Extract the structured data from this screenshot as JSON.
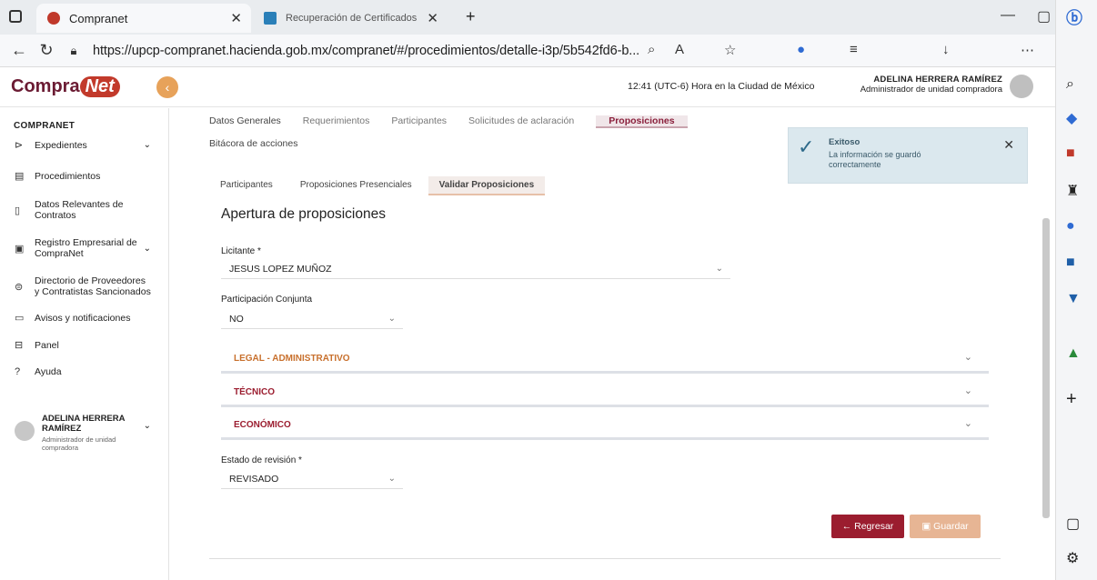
{
  "browser": {
    "tabs": [
      {
        "label": "Compranet",
        "active": true
      },
      {
        "label": "Recuperación de Certificados",
        "active": false
      }
    ],
    "url": "https://upcp-compranet.hacienda.gob.mx/compranet/#/procedimientos/detalle-i3p/5b542fd6-b..."
  },
  "header": {
    "logo_text": "Compra",
    "logo_net": "Net",
    "clock": "12:41 (UTC-6) Hora en la Ciudad de México",
    "user_name": "ADELINA HERRERA RAMÍREZ",
    "user_role": "Administrador de unidad compradora"
  },
  "sidebar": {
    "title": "COMPRANET",
    "items": [
      {
        "label": "Expedientes"
      },
      {
        "label": "Procedimientos"
      },
      {
        "label": "Datos Relevantes de Contratos"
      },
      {
        "label": "Registro Empresarial de CompraNet"
      },
      {
        "label": "Directorio de Proveedores y Contratistas Sancionados"
      },
      {
        "label": "Avisos y notificaciones"
      },
      {
        "label": "Panel"
      },
      {
        "label": "Ayuda"
      }
    ],
    "user_name": "ADELINA HERRERA RAMÍREZ",
    "user_role": "Administrador de unidad compradora"
  },
  "main": {
    "tabs": [
      "Datos Generales",
      "Requerimientos",
      "Participantes",
      "Solicitudes de aclaración",
      "Proposiciones"
    ],
    "bitacora": "Bitácora de acciones",
    "subtabs": [
      "Participantes",
      "Proposiciones Presenciales",
      "Validar Proposiciones"
    ],
    "heading": "Apertura de proposiciones",
    "licitante_label": "Licitante *",
    "licitante_value": "JESUS LOPEZ MUÑOZ",
    "conjunta_label": "Participación Conjunta",
    "conjunta_value": "NO",
    "sections": [
      "LEGAL - ADMINISTRATIVO",
      "TÉCNICO",
      "ECONÓMICO"
    ],
    "estado_label": "Estado de revisión *",
    "estado_value": "REVISADO",
    "back_label": "← Regresar",
    "save_label": "Guardar"
  },
  "toast": {
    "title": "Exitoso",
    "message": "La información se guardó correctamente"
  },
  "colors": {
    "brand": "#6b1b33",
    "accent_orange": "#c8702d",
    "back_button": "#9b1d2f",
    "save_button": "#e7b594",
    "toast_bg": "#dbe8ee"
  }
}
